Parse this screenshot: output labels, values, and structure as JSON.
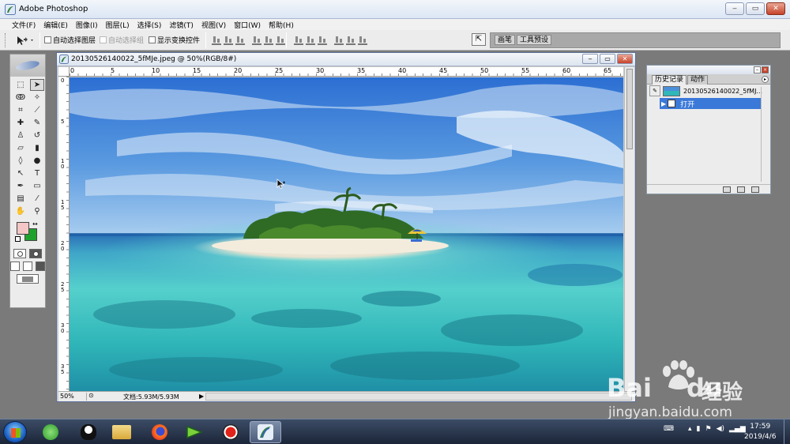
{
  "window": {
    "title": "Adobe Photoshop"
  },
  "menu": [
    "文件(F)",
    "编辑(E)",
    "图像(I)",
    "图层(L)",
    "选择(S)",
    "滤镜(T)",
    "视图(V)",
    "窗口(W)",
    "帮助(H)"
  ],
  "options": {
    "auto_select_layer": "自动选择图层",
    "auto_select_group": "自动选择组",
    "show_transform": "显示变换控件",
    "well_tabs": [
      "画笔",
      "工具预设"
    ]
  },
  "document": {
    "title": "20130526140022_5fMJe.jpeg @ 50%(RGB/8#)",
    "ruler_h": [
      "0",
      "5",
      "10",
      "15",
      "20",
      "25",
      "30",
      "35",
      "40",
      "45",
      "50",
      "55",
      "60",
      "65"
    ],
    "ruler_v": [
      "0",
      "5",
      "1 0",
      "1 5",
      "2 0",
      "2 5",
      "3 0",
      "3 5"
    ],
    "zoom": "50%",
    "doc_info": "文档:5.93M/5.93M"
  },
  "history": {
    "tabs": [
      "历史记录",
      "动作"
    ],
    "snapshot": "20130526140022_5fMJ...",
    "states": [
      "打开"
    ]
  },
  "taskbar": {
    "time": "17:59",
    "date": "2019/4/6"
  },
  "watermark": {
    "brand": "Bai",
    "brand_tail": "du",
    "cn": "经验",
    "url": "jingyan.baidu.com"
  },
  "icons": [
    "photoshop-icon",
    "move-tool-icon",
    "marquee-icon",
    "lasso-icon",
    "crop-icon",
    "brush-icon",
    "eraser-icon",
    "text-icon",
    "zoom-icon",
    "hand-icon",
    "eyedropper-icon"
  ]
}
